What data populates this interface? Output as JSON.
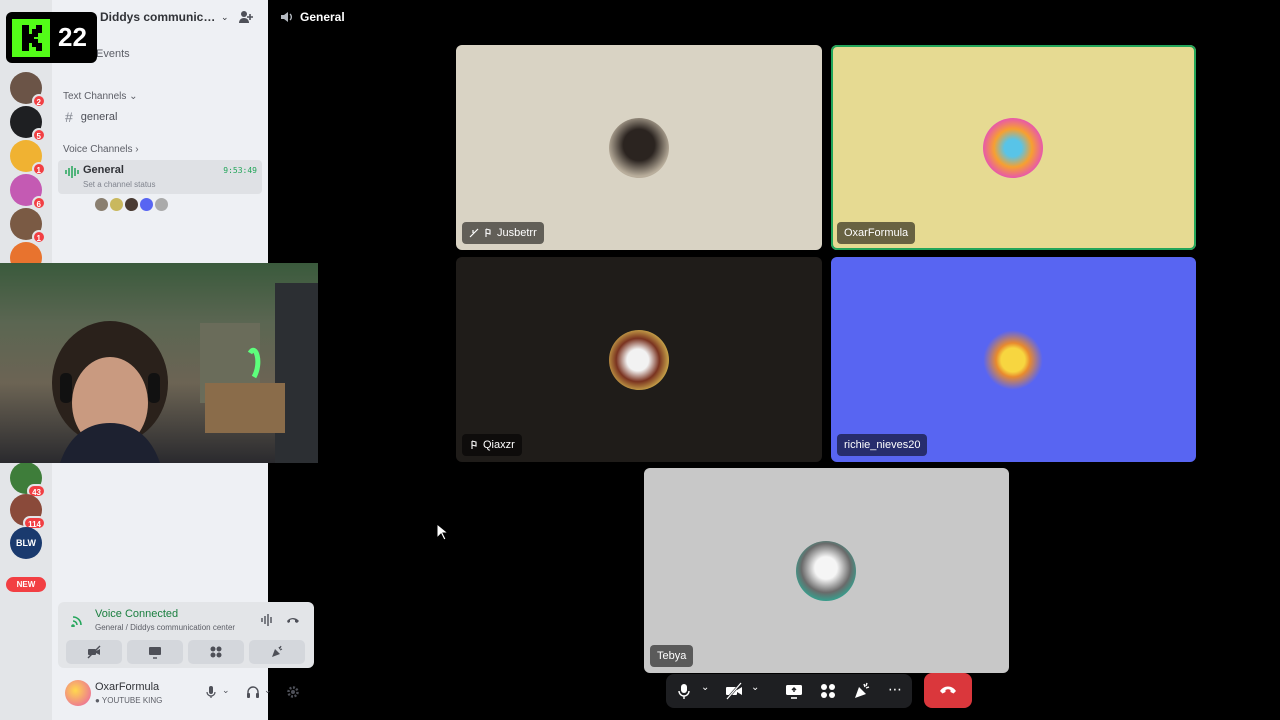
{
  "server": {
    "name": "Diddys communication center",
    "events_label": "Events",
    "text_category": "Text Channels",
    "voice_category": "Voice Channels",
    "text_channel": "general",
    "voice_channel": {
      "name": "General",
      "timer": "9:53:49",
      "status_placeholder": "Set a channel status"
    }
  },
  "rail": {
    "badges": [
      "2",
      "5",
      "1",
      "6",
      "1",
      "43",
      "114"
    ],
    "blw_label": "BLW",
    "new_label": "NEW"
  },
  "voice_panel": {
    "title": "Voice Connected",
    "subtitle": "General / Diddys communication center"
  },
  "user": {
    "name": "OxarFormula",
    "tagline": "YOUTUBE KING"
  },
  "overlay": {
    "kick_count": "22"
  },
  "main": {
    "channel_title": "General",
    "tiles": [
      {
        "name": "Jusbetrr",
        "bg": "#d9d3c4"
      },
      {
        "name": "OxarFormula",
        "bg": "#e6da92"
      },
      {
        "name": "Qiaxzr",
        "bg": "#1f1c19"
      },
      {
        "name": "richie_nieves20",
        "bg": "#5865f2"
      },
      {
        "name": "Tebya",
        "bg": "#c8c8c8"
      }
    ]
  },
  "colors": {
    "accent_green": "#23a55a",
    "hangup_red": "#da373c",
    "kick_green": "#53fc18",
    "blurple": "#5865f2"
  }
}
